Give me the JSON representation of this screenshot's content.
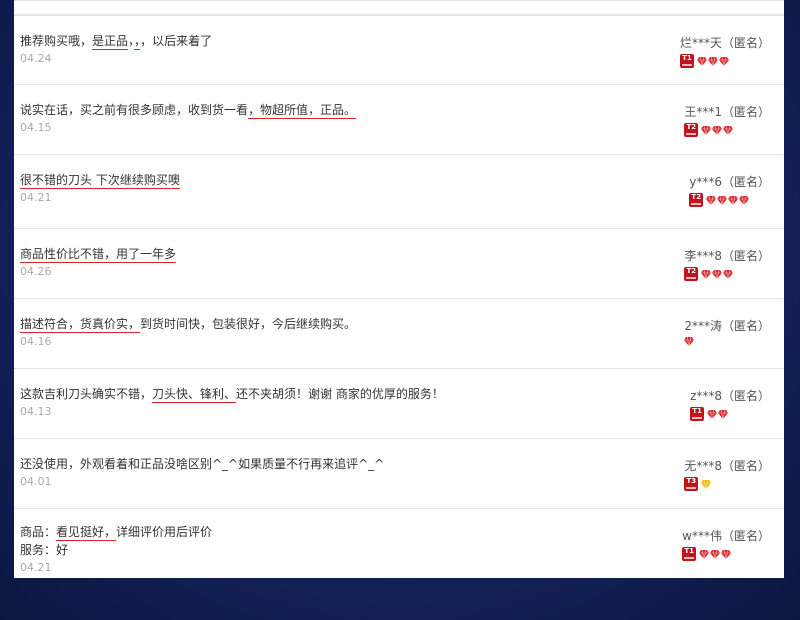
{
  "reviews": [
    {
      "lines": [
        {
          "parts": [
            {
              "t": "推荐购买哦，"
            },
            {
              "t": "是正品",
              "u": true
            },
            {
              "t": "，"
            },
            {
              "t": "，",
              "u": true
            },
            {
              "t": "，以后来着了"
            }
          ]
        }
      ],
      "date": "04.24",
      "user": "烂***天（匿名）",
      "level": "T1",
      "gems": 3,
      "gem_color": "#d7262b"
    },
    {
      "lines": [
        {
          "parts": [
            {
              "t": "说实在话，买之前有很多顾虑，收到货一看"
            },
            {
              "t": "，物超所值，正品。",
              "u": true
            }
          ]
        }
      ],
      "date": "04.15",
      "user": "王***1（匿名）",
      "level": "T2",
      "gems": 3,
      "gem_color": "#d7262b"
    },
    {
      "lines": [
        {
          "parts": [
            {
              "t": "很不错的刀头 下次继续购买噢",
              "u": true
            }
          ]
        }
      ],
      "date": "04.21",
      "user": "y***6（匿名）",
      "level": "T2",
      "gems": 4,
      "gem_color": "#d7262b"
    },
    {
      "lines": [
        {
          "parts": [
            {
              "t": "商品性价比不错，用了一年多",
              "u": true
            }
          ]
        }
      ],
      "date": "04.26",
      "user": "李***8（匿名）",
      "level": "T2",
      "gems": 3,
      "gem_color": "#d7262b"
    },
    {
      "lines": [
        {
          "parts": [
            {
              "t": "描述符合，",
              "u": true
            },
            {
              "t": "货真价实，",
              "u": true
            },
            {
              "t": "到货时间快，包装很好，今后继续购买。"
            }
          ]
        }
      ],
      "date": "04.16",
      "user": "2***涛（匿名）",
      "level": "",
      "gems": 1,
      "gem_color": "#d7262b"
    },
    {
      "lines": [
        {
          "parts": [
            {
              "t": "这款吉利刀头确实不错，"
            },
            {
              "t": "刀头快、锋利、",
              "u": true
            },
            {
              "t": "还不夹胡须！谢谢 商家的优厚的服务！"
            }
          ]
        }
      ],
      "date": "04.13",
      "user": "z***8（匿名）",
      "level": "T1",
      "gems": 2,
      "gem_color": "#d7262b"
    },
    {
      "lines": [
        {
          "parts": [
            {
              "t": "还没使用，外观看着和正品没啥区别^_^如果质量不行再来追评^_^"
            }
          ]
        }
      ],
      "date": "04.01",
      "user": "无***8（匿名）",
      "level": "T3",
      "gems": 1,
      "gem_color": "#f0b400"
    },
    {
      "lines": [
        {
          "parts": [
            {
              "t": "商品："
            },
            {
              "t": "看见挺好，",
              "u": true
            },
            {
              "t": "详细评价用后评价"
            }
          ]
        },
        {
          "parts": [
            {
              "t": "服务：好"
            }
          ]
        }
      ],
      "date": "04.21",
      "user": "w***伟（匿名）",
      "level": "T1",
      "gems": 3,
      "gem_color": "#d7262b"
    }
  ]
}
